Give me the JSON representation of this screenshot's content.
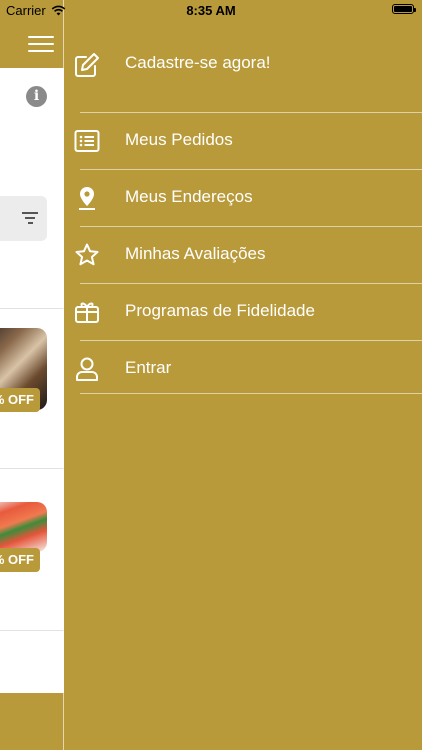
{
  "status_bar": {
    "carrier": "Carrier",
    "time": "8:35 AM"
  },
  "background_page": {
    "offers": [
      {
        "badge": "% OFF"
      },
      {
        "badge": "% OFF"
      }
    ]
  },
  "drawer": {
    "register": {
      "label": "Cadastre-se agora!",
      "icon": "edit-icon"
    },
    "items": [
      {
        "label": "Meus Pedidos",
        "icon": "list-icon"
      },
      {
        "label": "Meus Endereços",
        "icon": "location-pin-icon"
      },
      {
        "label": "Minhas Avaliações",
        "icon": "star-icon"
      },
      {
        "label": "Programas de Fidelidade",
        "icon": "gift-icon"
      },
      {
        "label": "Entrar",
        "icon": "user-icon"
      }
    ]
  },
  "colors": {
    "accent": "#b99a3a",
    "text_on_accent": "#ffffff"
  }
}
